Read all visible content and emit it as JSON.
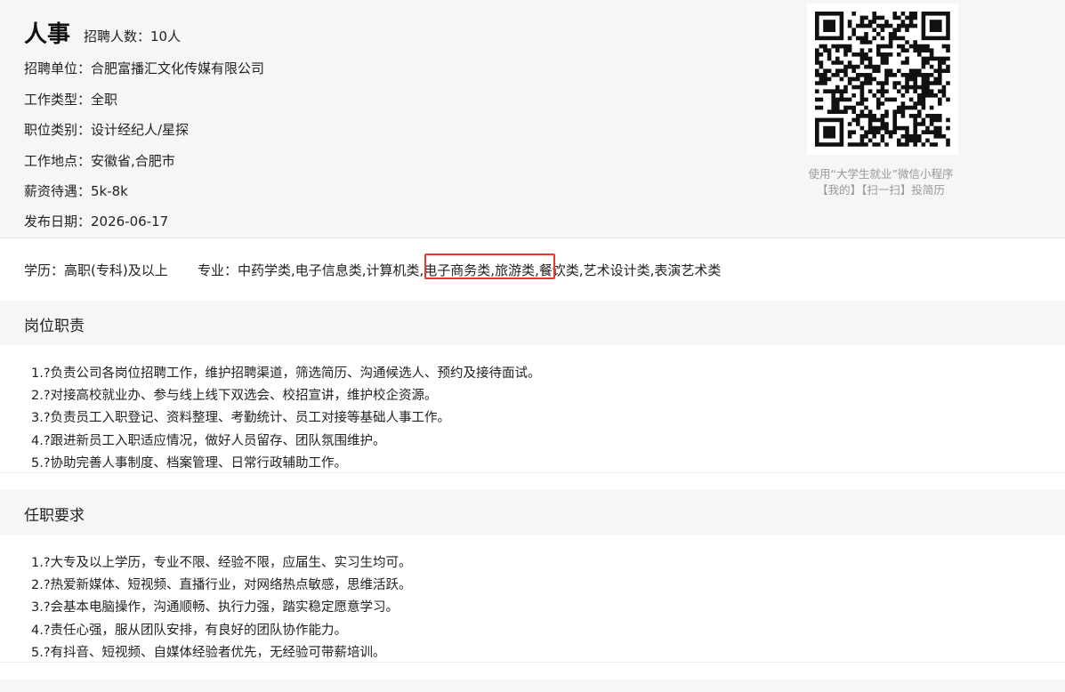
{
  "job": {
    "title": "人事",
    "recruit_count": "招聘人数：10人",
    "info": [
      "招聘单位：合肥富播汇文化传媒有限公司",
      "工作类型：全职",
      "职位类别：设计经纪人/星探",
      "工作地点：安徽省,合肥市",
      "薪资待遇：5k-8k",
      "发布日期：2026-06-17"
    ]
  },
  "qr": {
    "hint_line1": "使用“大学生就业”微信小程序",
    "hint_line2": "【我的】【扫一扫】投简历"
  },
  "requirements_summary": {
    "education": "学历：高职(专科)及以上",
    "major": "专业：中药学类,电子信息类,计算机类,电子商务类,旅游类,餐饮类,艺术设计类,表演艺术类"
  },
  "sections": {
    "duties": {
      "title": "岗位职责",
      "items": [
        "1.?负责公司各岗位招聘工作，维护招聘渠道，筛选简历、沟通候选人、预约及接待面试。",
        "2.?对接高校就业办、参与线上线下双选会、校招宣讲，维护校企资源。",
        "3.?负责员工入职登记、资料整理、考勤统计、员工对接等基础人事工作。",
        "4.?跟进新员工入职适应情况，做好人员留存、团队氛围维护。",
        "5.?协助完善人事制度、档案管理、日常行政辅助工作。"
      ]
    },
    "requirements": {
      "title": "任职要求",
      "items": [
        "1.?大专及以上学历，专业不限、经验不限，应届生、实习生均可。",
        "2.?热爱新媒体、短视频、直播行业，对网络热点敏感，思维活跃。",
        "3.?会基本电脑操作，沟通顺畅、执行力强，踏实稳定愿意学习。",
        "4.?责任心强，服从团队安排，有良好的团队协作能力。",
        "5.?有抖音、短视频、自媒体经验者优先，无经验可带薪培训。"
      ]
    }
  },
  "colors": {
    "highlight": "#e53935",
    "band": "#f6f6f6",
    "muted": "#999999"
  }
}
